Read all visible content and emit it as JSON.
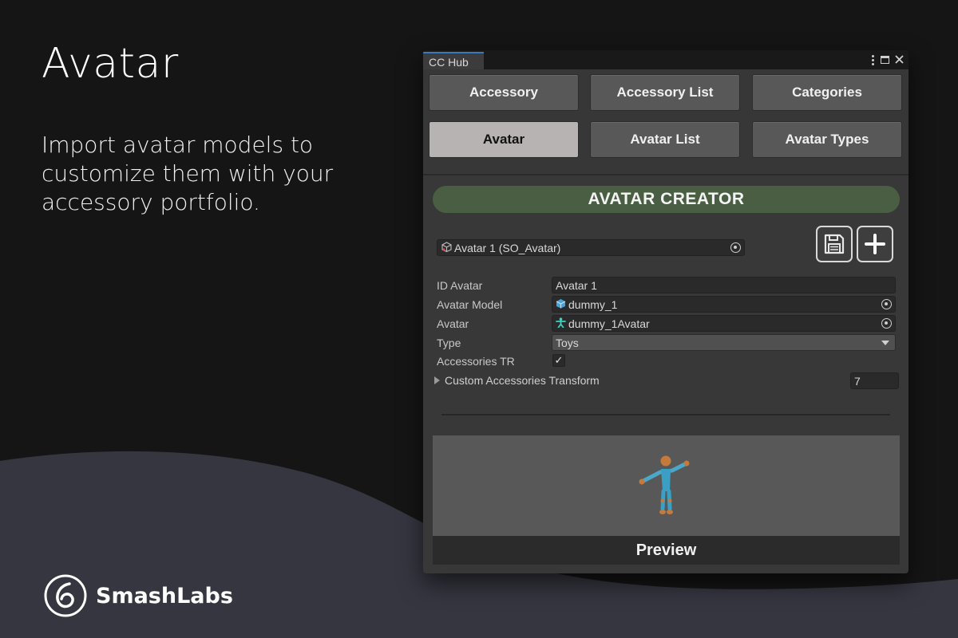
{
  "hero": {
    "title": "Avatar",
    "description": "Import avatar models to customize them with your accessory portfolio."
  },
  "brand": {
    "name": "SmashLabs"
  },
  "window": {
    "tab_title": "CC Hub",
    "controls": [
      "kebab-menu-icon",
      "maximize-icon",
      "close-icon"
    ]
  },
  "nav": {
    "row1": [
      "Accessory",
      "Accessory List",
      "Categories"
    ],
    "row2": [
      "Avatar",
      "Avatar List",
      "Avatar Types"
    ],
    "active": "Avatar"
  },
  "creator": {
    "header": "AVATAR CREATOR",
    "object_field": "Avatar 1 (SO_Avatar)",
    "save_icon": "floppy-disk-icon",
    "add_icon": "plus-icon"
  },
  "properties": {
    "id_label": "ID Avatar",
    "id_value": "Avatar 1",
    "model_label": "Avatar Model",
    "model_value": "dummy_1",
    "avatar_label": "Avatar",
    "avatar_value": "dummy_1Avatar",
    "type_label": "Type",
    "type_value": "Toys",
    "accessories_tr_label": "Accessories TR",
    "accessories_tr_checked": true,
    "custom_transform_label": "Custom Accessories Transform",
    "custom_transform_count": "7"
  },
  "preview": {
    "label": "Preview"
  },
  "colors": {
    "background": "#151515",
    "wave": "#363641",
    "window": "#383838",
    "creator_bar": "#4a5e43",
    "active_nav": "#b8b3b3",
    "tab_accent": "#3a79bb"
  }
}
